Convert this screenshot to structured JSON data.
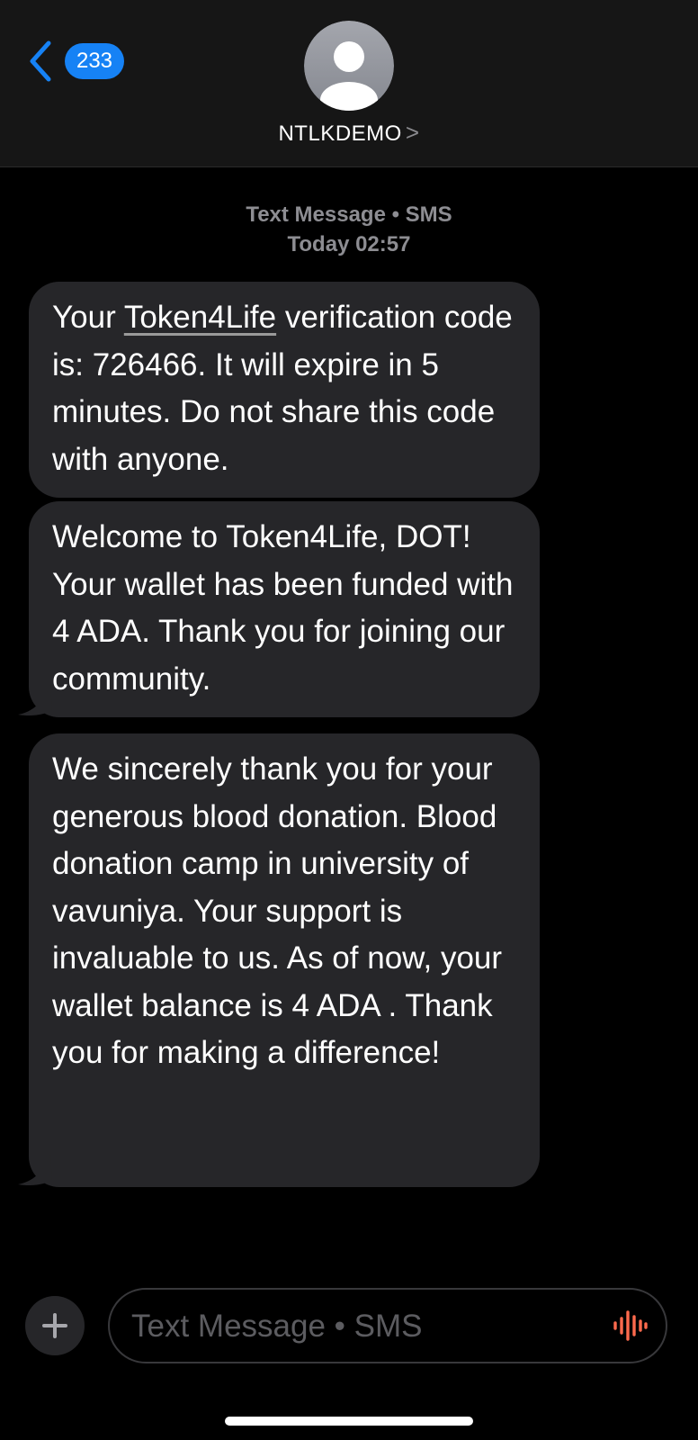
{
  "header": {
    "back_badge": "233",
    "contact_name": "NTLKDEMO",
    "contact_chevron": ">"
  },
  "thread_meta": {
    "service": "Text Message • SMS",
    "time": "Today 02:57"
  },
  "messages": [
    {
      "pre": "Your ",
      "link": "Token4Life",
      "post": " verification code is: 726466. It will expire in 5 minutes. Do not share this code with anyone."
    },
    {
      "text": "Welcome to Token4Life, DOT! Your wallet has been funded with 4 ADA. Thank you for joining our community."
    },
    {
      "text": "We sincerely thank you for your generous blood donation. Blood donation camp in university of vavuniya. Your support is invaluable to us. As of now, your wallet balance is 4 ADA . Thank you for making a difference!"
    }
  ],
  "composer": {
    "placeholder": "Text Message • SMS"
  },
  "colors": {
    "accent": "#1682f5",
    "bubble": "#262629",
    "mic": "#ff6a4d"
  },
  "icons": {
    "back": "chevron-left-icon",
    "avatar": "person-icon",
    "plus": "plus-icon",
    "mic": "waveform-icon"
  }
}
